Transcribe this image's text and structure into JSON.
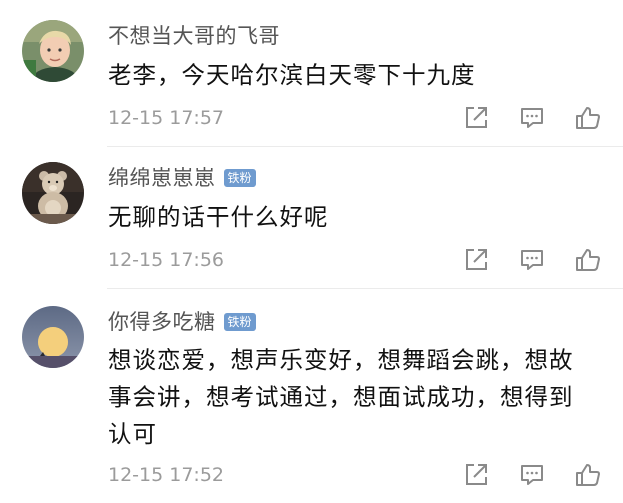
{
  "comments": [
    {
      "user": "不想当大哥的飞哥",
      "badge": "",
      "lines": [
        "老李，今天哈尔滨白天零下十九度"
      ],
      "time": "12-15 17:57",
      "avatar": "boy-photo"
    },
    {
      "user": "绵绵崽崽崽",
      "badge": "铁粉",
      "lines": [
        "无聊的话干什么好呢"
      ],
      "time": "12-15 17:56",
      "avatar": "teddy-bear-photo"
    },
    {
      "user": "你得多吃糖",
      "badge": "铁粉",
      "lines": [
        "想谈恋爱，想声乐变好，想舞蹈会跳，想故",
        "事会讲，想考试通过，想面试成功，想得到",
        "认可"
      ],
      "time": "12-15 17:52",
      "avatar": "moon-photo"
    }
  ],
  "icons": {
    "share": "share-icon",
    "reply": "comment-icon",
    "like": "thumbs-up-icon"
  },
  "colors": {
    "badge": "#6f9bcf",
    "username": "#555555",
    "timestamp": "#9b9b9b",
    "icon": "#8a8a8a"
  }
}
